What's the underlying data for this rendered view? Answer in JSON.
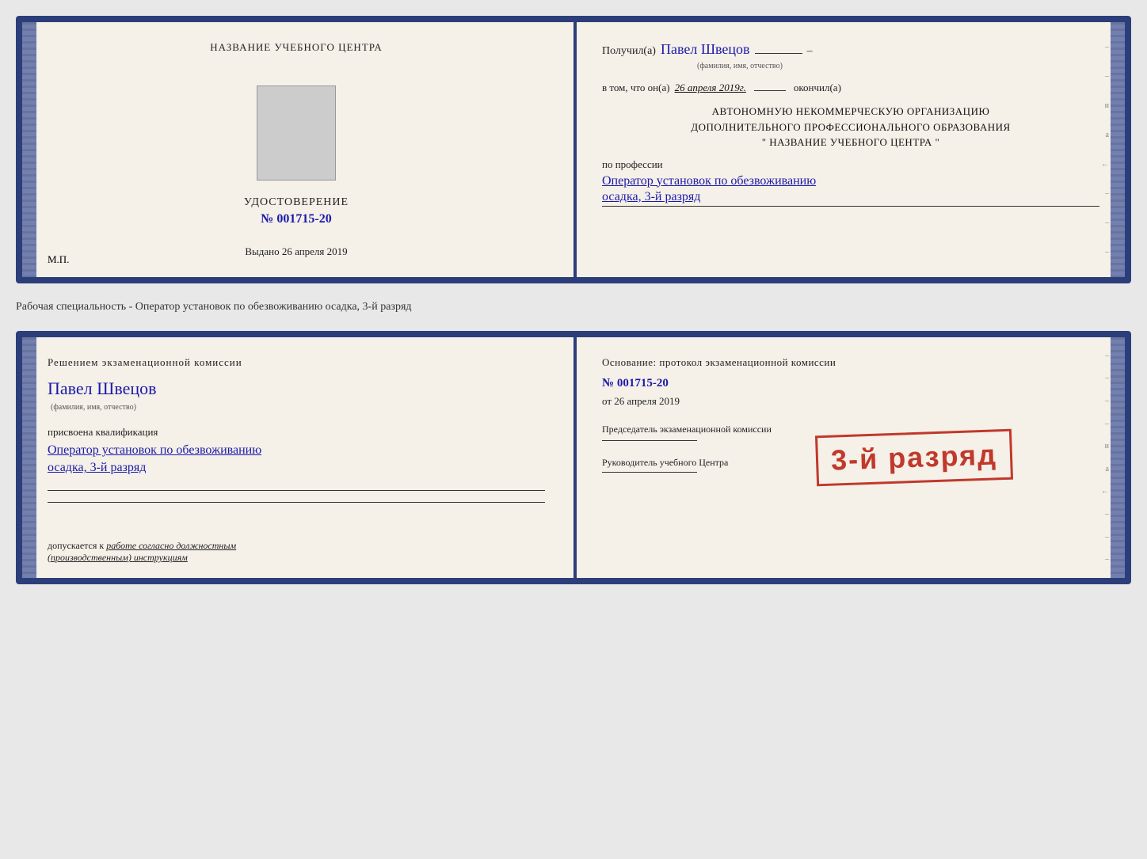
{
  "top_doc": {
    "left": {
      "center_title": "НАЗВАНИЕ УЧЕБНОГО ЦЕНТРА",
      "photo_alt": "photo",
      "udostoverenie_title": "УДОСТОВЕРЕНИЕ",
      "udostoverenie_num": "№ 001715-20",
      "vydano_label": "Выдано",
      "vydano_date": "26 апреля 2019",
      "mp_label": "М.П."
    },
    "right": {
      "poluchil_label": "Получил(а)",
      "poluchil_name": "Павел Швецов",
      "fio_sublabel": "(фамилия, имя, отчество)",
      "dash": "–",
      "vtom_label": "в том, что он(а)",
      "vtom_date": "26 апреля 2019г.",
      "okonchil_label": "окончил(а)",
      "org_line1": "АВТОНОМНУЮ НЕКОММЕРЧЕСКУЮ ОРГАНИЗАЦИЮ",
      "org_line2": "ДОПОЛНИТЕЛЬНОГО ПРОФЕССИОНАЛЬНОГО ОБРАЗОВАНИЯ",
      "org_line3": "\"  НАЗВАНИЕ УЧЕБНОГО ЦЕНТРА  \"",
      "po_professii_label": "по профессии",
      "profession": "Оператор установок по обезвоживанию",
      "razryad": "осадка, 3-й разряд"
    }
  },
  "middle_label": "Рабочая специальность - Оператор установок по обезвоживанию осадка, 3-й разряд",
  "bottom_doc": {
    "left": {
      "resheniyem_text": "Решением  экзаменационной  комиссии",
      "name": "Павел Швецов",
      "fio_sublabel": "(фамилия, имя, отчество)",
      "prisvoena_label": "присвоена квалификация",
      "profession": "Оператор установок по обезвоживанию",
      "razryad": "осадка, 3-й разряд",
      "dopuskaetsya_label": "допускается к",
      "dopuskaetsya_text": "работе согласно должностным (производственным) инструкциям"
    },
    "right": {
      "osnovanie_text": "Основание: протокол экзаменационной  комиссии",
      "protocol_num": "№  001715-20",
      "ot_label": "от",
      "ot_date": "26 апреля 2019",
      "predsedatel_label": "Председатель экзаменационной комиссии",
      "rukovoditel_label": "Руководитель учебного Центра"
    },
    "stamp": {
      "text": "3-й разряд"
    }
  }
}
